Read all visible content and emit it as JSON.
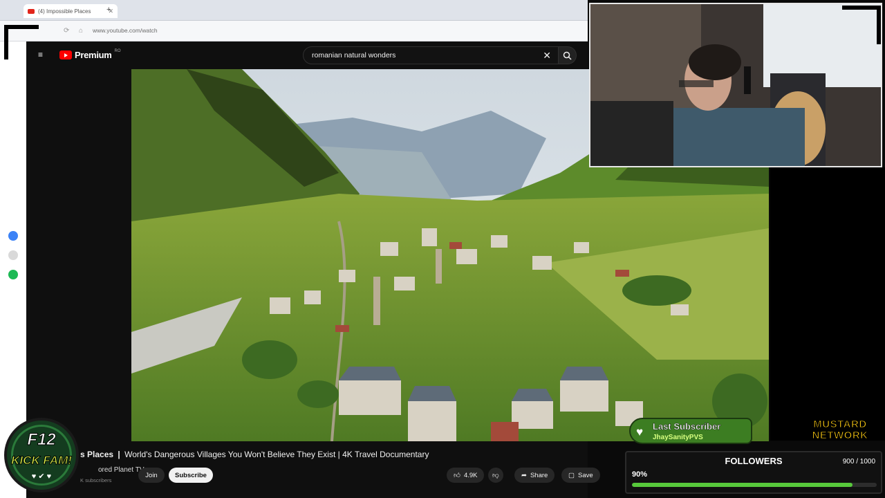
{
  "browser": {
    "tab_title": "(4) Impossible Places",
    "new_tab_glyph": "+",
    "url": "www.youtube.com/watch"
  },
  "youtube": {
    "logo_text": "Premium",
    "region": "RO",
    "search": {
      "value": "romanian natural wonders",
      "placeholder": "Search"
    },
    "video": {
      "title_partial": "s Places",
      "title": "World's Dangerous Villages You Won't Believe They Exist | 4K Travel Documentary",
      "channel": "ored Planet TV",
      "subscribers": "K subscribers",
      "join_label": "Join",
      "subscribe_label": "Subscribe",
      "likes": "4.9K",
      "share_label": "Share",
      "save_label": "Save"
    }
  },
  "overlays": {
    "kickfam": {
      "line1": "F12",
      "line2": "KICK FAM!",
      "hearts": "♥ ✔ ♥"
    },
    "last_subscriber": {
      "title": "Last Subscriber",
      "name": "JhaySanityPVS"
    },
    "network": {
      "line1": "MUSTARD",
      "line2": "NETWORK"
    },
    "followers": {
      "title": "FOLLOWERS",
      "count": "900 / 1000",
      "percent_label": "90%",
      "progress": 0.9
    }
  },
  "colors": {
    "accent": "#ff0000",
    "progress": "#57c93b",
    "badge": "#3c7d22",
    "network": "#f5c512"
  }
}
